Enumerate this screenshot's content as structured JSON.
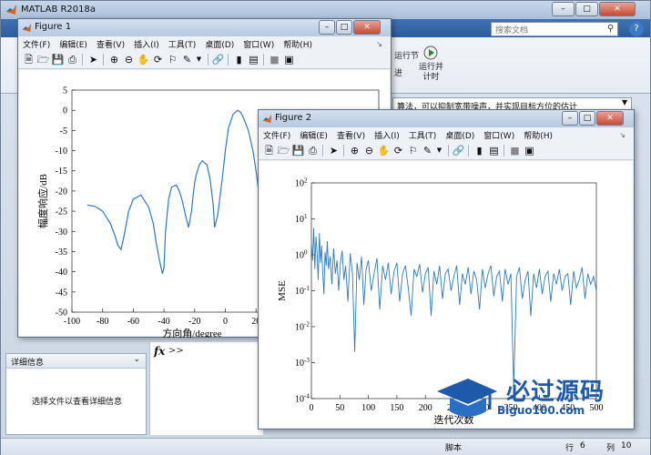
{
  "matlab": {
    "title": "MATLAB R2018a",
    "search_placeholder": "搜索文档",
    "ribbon_run_section": "运行节",
    "ribbon_advance": "进",
    "ribbon_run_and_time": "运行并\n计时",
    "address_text": "算法，可以抑制宽带噪声，并实现目标方位的估计",
    "details_header": "详细信息",
    "details_message": "选择文件以查看详细信息",
    "cmd_prompt": ">>",
    "status": {
      "script": "脚本",
      "row_label": "行",
      "row": "6",
      "col_label": "列",
      "col": "10"
    }
  },
  "figure1": {
    "title": "Figure 1",
    "menu": [
      "文件(F)",
      "编辑(E)",
      "查看(V)",
      "插入(I)",
      "工具(T)",
      "桌面(D)",
      "窗口(W)",
      "帮助(H)"
    ]
  },
  "figure2": {
    "title": "Figure 2",
    "menu": [
      "文件(F)",
      "编辑(E)",
      "查看(V)",
      "插入(I)",
      "工具(T)",
      "桌面(D)",
      "窗口(W)",
      "帮助(H)"
    ]
  },
  "watermark": {
    "text": "必过源码",
    "url": "Biguo100.com"
  },
  "colors": {
    "line": "#2b7bc0",
    "titlebar": "#b6c9e0"
  },
  "chart_data": [
    {
      "type": "line",
      "xlabel": "方向角/degree",
      "ylabel": "幅度响应/dB",
      "xlim": [
        -100,
        100
      ],
      "ylim": [
        -50,
        5
      ],
      "xticks": [
        -100,
        -80,
        -60,
        -40,
        -20,
        0,
        20
      ],
      "yticks": [
        5,
        0,
        -5,
        -10,
        -15,
        -20,
        -25,
        -30,
        -35,
        -40,
        -45,
        -50
      ],
      "series": [
        {
          "x": [
            -90,
            -85,
            -80,
            -75,
            -72,
            -70,
            -68,
            -66,
            -63,
            -60,
            -55,
            -50,
            -47,
            -45,
            -43,
            -41,
            -40,
            -39,
            -37,
            -35,
            -32,
            -30,
            -28,
            -26,
            -24,
            -22,
            -21,
            -20,
            -19,
            -17,
            -15,
            -12,
            -10,
            -9,
            -8,
            -7,
            -5,
            -2,
            0,
            2,
            5,
            8,
            10,
            12,
            15,
            18,
            20,
            22,
            24
          ],
          "y": [
            -23.5,
            -23.8,
            -25,
            -28,
            -31,
            -33.5,
            -34.5,
            -31,
            -25,
            -22,
            -21,
            -24,
            -28,
            -33,
            -37,
            -40.5,
            -39,
            -30,
            -22,
            -19,
            -18.5,
            -20,
            -22.5,
            -26,
            -29,
            -25,
            -21,
            -18,
            -16,
            -13.5,
            -12.5,
            -13.5,
            -17,
            -20,
            -23,
            -29,
            -26,
            -17,
            -10,
            -4.5,
            -1,
            0,
            -0.5,
            -2,
            -5,
            -10,
            -15,
            -21,
            -32
          ]
        }
      ]
    },
    {
      "type": "line",
      "xlabel": "迭代次数",
      "ylabel": "MSE",
      "xlim": [
        0,
        500
      ],
      "ylim_log10": [
        -4,
        2
      ],
      "xticks": [
        0,
        50,
        100,
        150,
        200,
        250,
        300,
        350,
        400,
        450,
        500
      ],
      "yticks": [
        "10^2",
        "10^1",
        "10^0",
        "10^-1",
        "10^-2",
        "10^-3",
        "10^-4"
      ],
      "series": [
        {
          "x": [
            0,
            2,
            4,
            6,
            8,
            10,
            12,
            14,
            16,
            18,
            20,
            22,
            24,
            26,
            28,
            30,
            33,
            36,
            39,
            42,
            45,
            48,
            51,
            54,
            57,
            60,
            64,
            68,
            72,
            76,
            80,
            84,
            88,
            92,
            96,
            100,
            105,
            110,
            115,
            120,
            125,
            130,
            135,
            140,
            145,
            150,
            155,
            160,
            165,
            170,
            175,
            180,
            185,
            190,
            195,
            200,
            205,
            210,
            215,
            220,
            225,
            230,
            235,
            240,
            245,
            250,
            255,
            260,
            265,
            270,
            275,
            280,
            285,
            290,
            295,
            300,
            305,
            310,
            315,
            320,
            325,
            330,
            335,
            340,
            345,
            350,
            355,
            360,
            365,
            370,
            375,
            380,
            385,
            390,
            395,
            400,
            405,
            410,
            415,
            420,
            425,
            430,
            435,
            440,
            445,
            450,
            455,
            460,
            465,
            470,
            475,
            480,
            485,
            490,
            495,
            500
          ],
          "y": [
            2.1,
            0.7,
            5.5,
            0.4,
            3.2,
            1.1,
            0.2,
            4.0,
            0.6,
            1.8,
            0.3,
            0.08,
            1.2,
            0.5,
            2.4,
            0.4,
            0.9,
            0.15,
            1.5,
            0.3,
            0.7,
            0.1,
            0.6,
            1.3,
            0.2,
            0.5,
            0.05,
            1.1,
            0.3,
            0.002,
            0.6,
            0.2,
            0.9,
            0.04,
            0.4,
            0.7,
            0.1,
            0.3,
            0.8,
            0.03,
            0.5,
            0.2,
            0.6,
            0.08,
            0.35,
            0.6,
            0.05,
            0.3,
            0.5,
            0.12,
            0.02,
            0.4,
            0.25,
            0.55,
            0.09,
            0.3,
            0.45,
            0.02,
            0.35,
            0.15,
            0.5,
            0.06,
            0.3,
            0.4,
            0.1,
            0.25,
            0.5,
            0.04,
            0.3,
            0.15,
            0.45,
            0.08,
            0.35,
            0.2,
            0.03,
            0.4,
            0.12,
            0.3,
            0.5,
            0.07,
            0.25,
            0.35,
            0.05,
            0.4,
            0.15,
            0.3,
            0.0002,
            0.25,
            0.45,
            0.06,
            0.2,
            0.35,
            0.02,
            0.3,
            0.12,
            0.4,
            0.08,
            0.25,
            0.35,
            0.05,
            0.3,
            0.15,
            0.4,
            0.1,
            0.25,
            0.3,
            0.04,
            0.35,
            0.12,
            0.2,
            0.45,
            0.06,
            0.3,
            0.15,
            0.25,
            0.1
          ]
        }
      ]
    }
  ]
}
